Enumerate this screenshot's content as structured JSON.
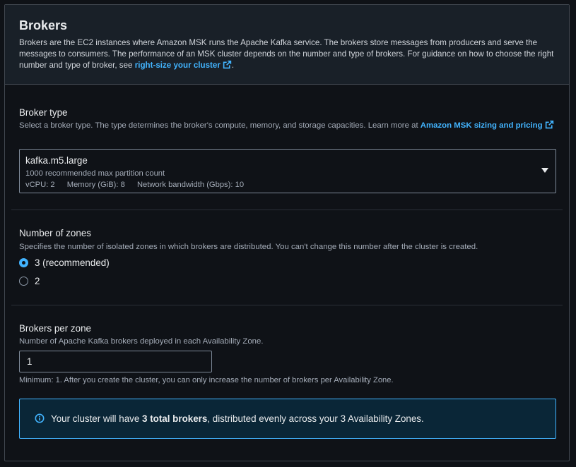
{
  "header": {
    "title": "Brokers",
    "description": "Brokers are the EC2 instances where Amazon MSK runs the Apache Kafka service. The brokers store messages from producers and serve the messages to consumers. The performance of an MSK cluster depends on the number and type of brokers. For guidance on how to choose the right number and type of broker, see",
    "link_text": "right-size your cluster",
    "desc_end": "."
  },
  "broker_type": {
    "label": "Broker type",
    "description": "Select a broker type. The type determines the broker's compute, memory, and storage capacities. Learn more at",
    "link_text": "Amazon MSK sizing and pricing",
    "selected": {
      "title": "kafka.m5.large",
      "subtitle": "1000 recommended max partition count",
      "vcpu": "vCPU:  2",
      "memory": "Memory (GiB): 8",
      "network": "Network bandwidth (Gbps): 10"
    }
  },
  "zones": {
    "label": "Number of zones",
    "description": "Specifies the number of isolated zones in which brokers are distributed. You can't change this number after the cluster is created.",
    "options": [
      {
        "label": "3 (recommended)",
        "checked": true
      },
      {
        "label": "2",
        "checked": false
      }
    ]
  },
  "brokers_per_zone": {
    "label": "Brokers per zone",
    "description": "Number of Apache Kafka brokers deployed in each Availability Zone.",
    "value": "1",
    "hint": "Minimum: 1. After you create the cluster, you can only increase the number of brokers per Availability Zone."
  },
  "info": {
    "prefix": "Your cluster will have",
    "bold": "3 total brokers",
    "suffix": ", distributed evenly across your 3 Availability Zones."
  },
  "colors": {
    "accent": "#42b4ff",
    "info_bg": "#0a2637",
    "header_bg": "#192028"
  },
  "icons": {
    "external": "external-link-icon",
    "info": "info-icon",
    "caret": "caret-down-icon"
  }
}
